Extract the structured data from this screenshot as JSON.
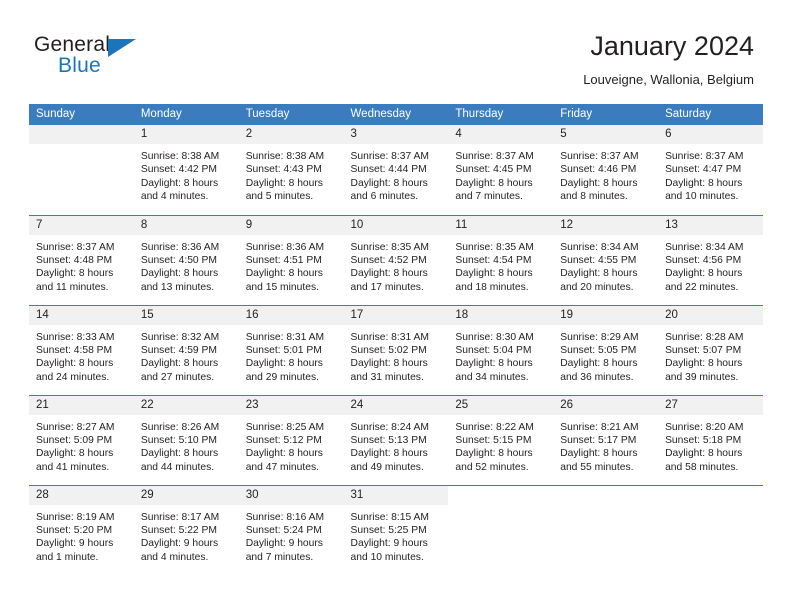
{
  "brand": {
    "word_general": "General",
    "word_blue": "Blue",
    "flag_icon": "triangle-flag-icon",
    "accent_color": "#1b75bb"
  },
  "header": {
    "title": "January 2024",
    "subtitle": "Louveigne, Wallonia, Belgium"
  },
  "calendar": {
    "header_bg": "#3a7cbe",
    "daynum_bg": "#f1f1f1",
    "weekdays": [
      "Sunday",
      "Monday",
      "Tuesday",
      "Wednesday",
      "Thursday",
      "Friday",
      "Saturday"
    ],
    "weeks": [
      [
        {
          "day": "",
          "lines": []
        },
        {
          "day": "1",
          "lines": [
            "Sunrise: 8:38 AM",
            "Sunset: 4:42 PM",
            "Daylight: 8 hours",
            "and 4 minutes."
          ]
        },
        {
          "day": "2",
          "lines": [
            "Sunrise: 8:38 AM",
            "Sunset: 4:43 PM",
            "Daylight: 8 hours",
            "and 5 minutes."
          ]
        },
        {
          "day": "3",
          "lines": [
            "Sunrise: 8:37 AM",
            "Sunset: 4:44 PM",
            "Daylight: 8 hours",
            "and 6 minutes."
          ]
        },
        {
          "day": "4",
          "lines": [
            "Sunrise: 8:37 AM",
            "Sunset: 4:45 PM",
            "Daylight: 8 hours",
            "and 7 minutes."
          ]
        },
        {
          "day": "5",
          "lines": [
            "Sunrise: 8:37 AM",
            "Sunset: 4:46 PM",
            "Daylight: 8 hours",
            "and 8 minutes."
          ]
        },
        {
          "day": "6",
          "lines": [
            "Sunrise: 8:37 AM",
            "Sunset: 4:47 PM",
            "Daylight: 8 hours",
            "and 10 minutes."
          ]
        }
      ],
      [
        {
          "day": "7",
          "lines": [
            "Sunrise: 8:37 AM",
            "Sunset: 4:48 PM",
            "Daylight: 8 hours",
            "and 11 minutes."
          ]
        },
        {
          "day": "8",
          "lines": [
            "Sunrise: 8:36 AM",
            "Sunset: 4:50 PM",
            "Daylight: 8 hours",
            "and 13 minutes."
          ]
        },
        {
          "day": "9",
          "lines": [
            "Sunrise: 8:36 AM",
            "Sunset: 4:51 PM",
            "Daylight: 8 hours",
            "and 15 minutes."
          ]
        },
        {
          "day": "10",
          "lines": [
            "Sunrise: 8:35 AM",
            "Sunset: 4:52 PM",
            "Daylight: 8 hours",
            "and 17 minutes."
          ]
        },
        {
          "day": "11",
          "lines": [
            "Sunrise: 8:35 AM",
            "Sunset: 4:54 PM",
            "Daylight: 8 hours",
            "and 18 minutes."
          ]
        },
        {
          "day": "12",
          "lines": [
            "Sunrise: 8:34 AM",
            "Sunset: 4:55 PM",
            "Daylight: 8 hours",
            "and 20 minutes."
          ]
        },
        {
          "day": "13",
          "lines": [
            "Sunrise: 8:34 AM",
            "Sunset: 4:56 PM",
            "Daylight: 8 hours",
            "and 22 minutes."
          ]
        }
      ],
      [
        {
          "day": "14",
          "lines": [
            "Sunrise: 8:33 AM",
            "Sunset: 4:58 PM",
            "Daylight: 8 hours",
            "and 24 minutes."
          ]
        },
        {
          "day": "15",
          "lines": [
            "Sunrise: 8:32 AM",
            "Sunset: 4:59 PM",
            "Daylight: 8 hours",
            "and 27 minutes."
          ]
        },
        {
          "day": "16",
          "lines": [
            "Sunrise: 8:31 AM",
            "Sunset: 5:01 PM",
            "Daylight: 8 hours",
            "and 29 minutes."
          ]
        },
        {
          "day": "17",
          "lines": [
            "Sunrise: 8:31 AM",
            "Sunset: 5:02 PM",
            "Daylight: 8 hours",
            "and 31 minutes."
          ]
        },
        {
          "day": "18",
          "lines": [
            "Sunrise: 8:30 AM",
            "Sunset: 5:04 PM",
            "Daylight: 8 hours",
            "and 34 minutes."
          ]
        },
        {
          "day": "19",
          "lines": [
            "Sunrise: 8:29 AM",
            "Sunset: 5:05 PM",
            "Daylight: 8 hours",
            "and 36 minutes."
          ]
        },
        {
          "day": "20",
          "lines": [
            "Sunrise: 8:28 AM",
            "Sunset: 5:07 PM",
            "Daylight: 8 hours",
            "and 39 minutes."
          ]
        }
      ],
      [
        {
          "day": "21",
          "lines": [
            "Sunrise: 8:27 AM",
            "Sunset: 5:09 PM",
            "Daylight: 8 hours",
            "and 41 minutes."
          ]
        },
        {
          "day": "22",
          "lines": [
            "Sunrise: 8:26 AM",
            "Sunset: 5:10 PM",
            "Daylight: 8 hours",
            "and 44 minutes."
          ]
        },
        {
          "day": "23",
          "lines": [
            "Sunrise: 8:25 AM",
            "Sunset: 5:12 PM",
            "Daylight: 8 hours",
            "and 47 minutes."
          ]
        },
        {
          "day": "24",
          "lines": [
            "Sunrise: 8:24 AM",
            "Sunset: 5:13 PM",
            "Daylight: 8 hours",
            "and 49 minutes."
          ]
        },
        {
          "day": "25",
          "lines": [
            "Sunrise: 8:22 AM",
            "Sunset: 5:15 PM",
            "Daylight: 8 hours",
            "and 52 minutes."
          ]
        },
        {
          "day": "26",
          "lines": [
            "Sunrise: 8:21 AM",
            "Sunset: 5:17 PM",
            "Daylight: 8 hours",
            "and 55 minutes."
          ]
        },
        {
          "day": "27",
          "lines": [
            "Sunrise: 8:20 AM",
            "Sunset: 5:18 PM",
            "Daylight: 8 hours",
            "and 58 minutes."
          ]
        }
      ],
      [
        {
          "day": "28",
          "lines": [
            "Sunrise: 8:19 AM",
            "Sunset: 5:20 PM",
            "Daylight: 9 hours",
            "and 1 minute."
          ]
        },
        {
          "day": "29",
          "lines": [
            "Sunrise: 8:17 AM",
            "Sunset: 5:22 PM",
            "Daylight: 9 hours",
            "and 4 minutes."
          ]
        },
        {
          "day": "30",
          "lines": [
            "Sunrise: 8:16 AM",
            "Sunset: 5:24 PM",
            "Daylight: 9 hours",
            "and 7 minutes."
          ]
        },
        {
          "day": "31",
          "lines": [
            "Sunrise: 8:15 AM",
            "Sunset: 5:25 PM",
            "Daylight: 9 hours",
            "and 10 minutes."
          ]
        },
        {
          "day": "",
          "lines": []
        },
        {
          "day": "",
          "lines": []
        },
        {
          "day": "",
          "lines": []
        }
      ]
    ]
  }
}
